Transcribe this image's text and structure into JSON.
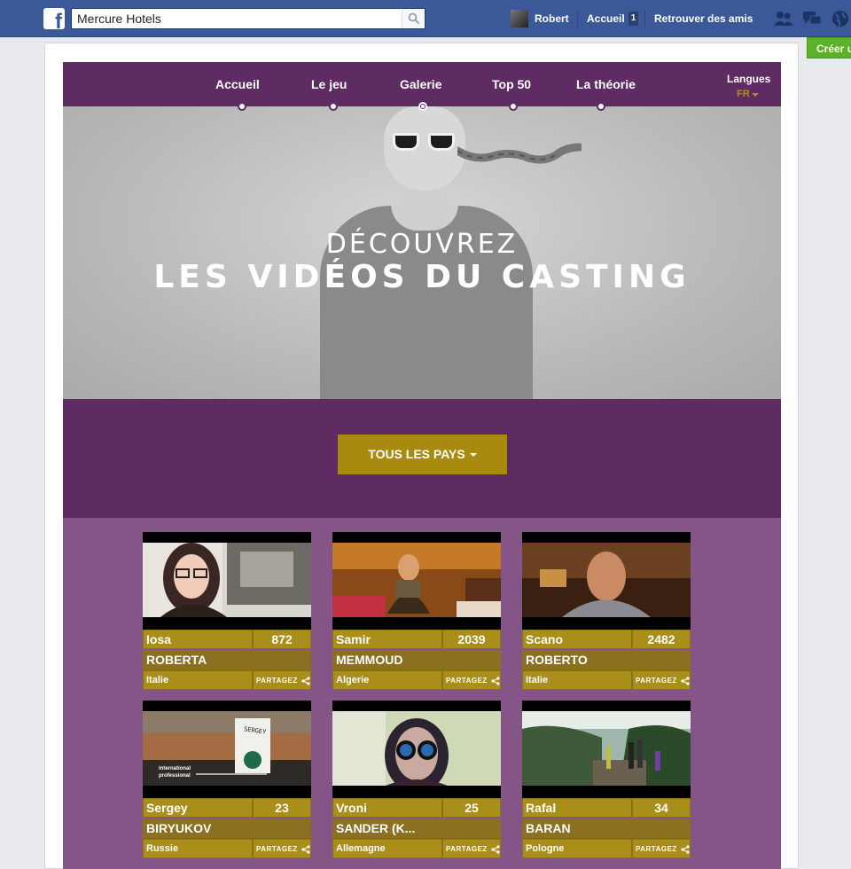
{
  "facebook": {
    "search_value": "Mercure Hotels",
    "user_name": "Robert",
    "home_label": "Accueil",
    "home_badge": "1",
    "find_friends_label": "Retrouver des amis",
    "create_label": "Créer u"
  },
  "app": {
    "nav": [
      {
        "label": "Accueil"
      },
      {
        "label": "Le jeu"
      },
      {
        "label": "Galerie"
      },
      {
        "label": "Top 50"
      },
      {
        "label": "La théorie"
      }
    ],
    "active_nav": "Galerie",
    "language_label": "Langues",
    "language_value": "FR",
    "hero_subtitle": "DÉCOUVREZ",
    "hero_title": "LES VIDÉOS DU CASTING",
    "filter_label": "TOUS LES PAYS",
    "share_label": "PARTAGEZ",
    "colors": {
      "purple": "#5e2b63",
      "gallery_bg": "#845586",
      "gold": "#aa8e1a"
    }
  },
  "videos": [
    {
      "first_name": "Iosa",
      "last_name": "ROBERTA",
      "votes": "872",
      "country": "Italie"
    },
    {
      "first_name": "Samir",
      "last_name": "MEMMOUD",
      "votes": "2039",
      "country": "Algerie"
    },
    {
      "first_name": "Scano",
      "last_name": "ROBERTO",
      "votes": "2482",
      "country": "Italie"
    },
    {
      "first_name": "Sergey",
      "last_name": "BIRYUKOV",
      "votes": "23",
      "country": "Russie",
      "thumb_text_1": "international",
      "thumb_text_2": "professional",
      "cup_text": "SERGEY"
    },
    {
      "first_name": "Vroni",
      "last_name": "SANDER (K...",
      "votes": "25",
      "country": "Allemagne"
    },
    {
      "first_name": "Rafal",
      "last_name": "BARAN",
      "votes": "34",
      "country": "Pologne"
    }
  ]
}
